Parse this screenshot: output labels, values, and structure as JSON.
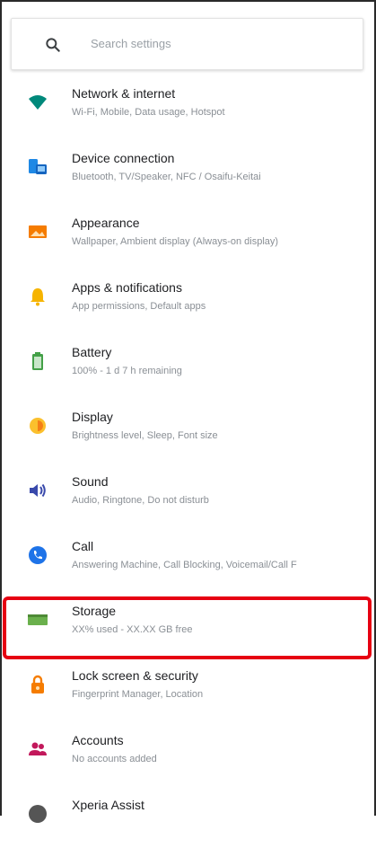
{
  "search": {
    "placeholder": "Search settings",
    "icon": "search-icon"
  },
  "items": [
    {
      "title": "Network & internet",
      "subtitle": "Wi-Fi, Mobile, Data usage, Hotspot",
      "icon": "wifi-icon",
      "color": "#00897b"
    },
    {
      "title": "Device connection",
      "subtitle": "Bluetooth, TV/Speaker, NFC / Osaifu-Keitai",
      "icon": "device-connection-icon",
      "color": "#1e88e5"
    },
    {
      "title": "Appearance",
      "subtitle": "Wallpaper, Ambient display (Always-on display)",
      "icon": "appearance-icon",
      "color": "#f57c00"
    },
    {
      "title": "Apps & notifications",
      "subtitle": "App permissions, Default apps",
      "icon": "apps-icon",
      "color": "#f6b400"
    },
    {
      "title": "Battery",
      "subtitle": "100% - 1 d 7 h remaining",
      "icon": "battery-icon",
      "color": "#43a047"
    },
    {
      "title": "Display",
      "subtitle": "Brightness level, Sleep, Font size",
      "icon": "display-icon",
      "color": "#fbc02d"
    },
    {
      "title": "Sound",
      "subtitle": "Audio, Ringtone, Do not disturb",
      "icon": "sound-icon",
      "color": "#3949ab"
    },
    {
      "title": "Call",
      "subtitle": "Answering Machine, Call Blocking, Voicemail/Call F",
      "icon": "call-icon",
      "color": "#1e73e8"
    },
    {
      "title": "Storage",
      "subtitle": "XX% used - XX.XX GB free",
      "icon": "storage-icon",
      "color": "#6ab04c"
    },
    {
      "title": "Lock screen & security",
      "subtitle": "Fingerprint Manager, Location",
      "icon": "lock-icon",
      "color": "#f57c00"
    },
    {
      "title": "Accounts",
      "subtitle": "No accounts added",
      "icon": "accounts-icon",
      "color": "#c2185b"
    },
    {
      "title": "Xperia Assist",
      "subtitle": "",
      "icon": "xperia-assist-icon",
      "color": "#555555"
    }
  ],
  "highlight": {
    "target": "Storage",
    "color": "#e60012"
  }
}
